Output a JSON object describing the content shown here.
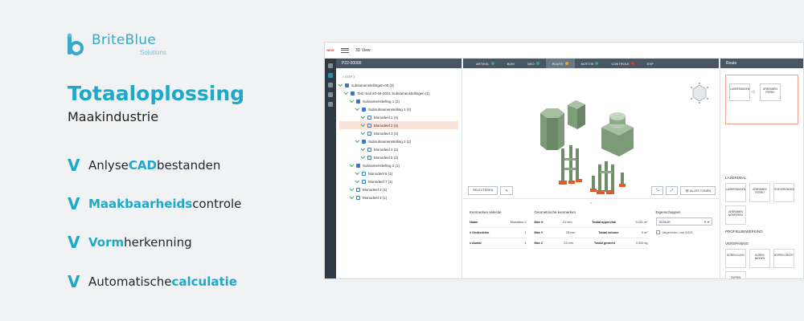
{
  "brand": {
    "name": "BriteBlue",
    "sub": "Solutions"
  },
  "headline": "Totaaloplossing",
  "subline": "Maakindustrie",
  "features": [
    {
      "pre": "Anlyse ",
      "hl": "CAD",
      "post": " bestanden"
    },
    {
      "pre": "",
      "hl": "Maakbaarheids",
      "post": " controle"
    },
    {
      "pre": "",
      "hl": "Vorm",
      "post": " herkenning"
    },
    {
      "pre": "Automatische ",
      "hl": "calculatie",
      "post": ""
    }
  ],
  "app": {
    "title": "3D View",
    "logo": "NEW",
    "left_header": "P22-00000",
    "step_back": "< STEP 3",
    "tree": [
      {
        "label": "subsamenstellingen-00 (3)",
        "indent": 0
      },
      {
        "label": "Test mail 20-04-2021 Subsamenstellingen (1)",
        "indent": 1
      },
      {
        "label": "Subsamenstelling 1 (2)",
        "indent": 2
      },
      {
        "label": "Subsubsamenstelling 1 (4)",
        "indent": 3
      },
      {
        "label": "Monodeel 1 (4)",
        "indent": 4
      },
      {
        "label": "Monodeel 2 (4)",
        "indent": 4,
        "selected": true
      },
      {
        "label": "Monodeel 3 (4)",
        "indent": 4
      },
      {
        "label": "Subsubsamenstelling 2 (2)",
        "indent": 3
      },
      {
        "label": "Monodeel 4 (2)",
        "indent": 4
      },
      {
        "label": "Monodeel 5 (2)",
        "indent": 4
      },
      {
        "label": "Subsamenstelling 2 (1)",
        "indent": 2
      },
      {
        "label": "Monodeel 6 (1)",
        "indent": 3
      },
      {
        "label": "Monodeel 7 (1)",
        "indent": 3
      },
      {
        "label": "Monodeel 3 (1)",
        "indent": 2
      },
      {
        "label": "Monodeel 3 (1)",
        "indent": 2
      }
    ],
    "tabs": [
      {
        "label": "ARTIKEL",
        "color": "#3aa86a"
      },
      {
        "label": "BOM",
        "color": ""
      },
      {
        "label": "GEO",
        "color": "#3aa86a"
      },
      {
        "label": "ROUTE",
        "color": "#f0a020",
        "active": true
      },
      {
        "label": "NOTITIE",
        "color": "#3aa86a"
      },
      {
        "label": "CONTROLE",
        "color": "#e0382b"
      },
      {
        "label": "EXP",
        "color": ""
      }
    ],
    "view_select": "SELECTEREN",
    "view_showall": "ALLES TONEN",
    "props_toggle": "^",
    "props": {
      "col1_title": "Kenmerken selectie",
      "col1": [
        {
          "k": "Naam",
          "v": "Monodeel 2"
        },
        {
          "k": "# Onderdelen",
          "v": "1"
        },
        {
          "k": "# Aantal",
          "v": "4"
        }
      ],
      "col2_title": "Geometrische kenmerken",
      "col2": [
        {
          "k": "Max X",
          "v": "21 mm",
          "k2": "Totaal oppervlak",
          "v2": "9.001 m²"
        },
        {
          "k": "Max Y",
          "v": "25 mm",
          "k2": "Totaal volume",
          "v2": "0 m³"
        },
        {
          "k": "Max Z",
          "v": "23 mm",
          "k2": "Totaal gewicht",
          "v2": "0.000 kg"
        }
      ],
      "col3_title": "Eigenschappen",
      "material_label": "S235JR",
      "uitgesloten": "Uitgesloten van AIDS"
    },
    "route_header": "Route",
    "route_nodes": [
      "LASERSNIJDEN",
      "AFBRAMEN FERRO"
    ],
    "sections": [
      {
        "title": "LASERDEAL",
        "tiles": [
          "LASERSNIJDEN",
          "AFBRAMEN FERRO",
          "SOEVERIJNGEN",
          "AFBRAMEN NOHFERRO"
        ]
      },
      {
        "title": "PROFIELBEWERKING",
        "tiles": []
      },
      {
        "title": "VERSPANING",
        "tiles": [
          "BOREN KLEIN",
          "BOREN MIDDEN",
          "BOREN GROOT",
          "TAPPEN"
        ]
      }
    ]
  }
}
